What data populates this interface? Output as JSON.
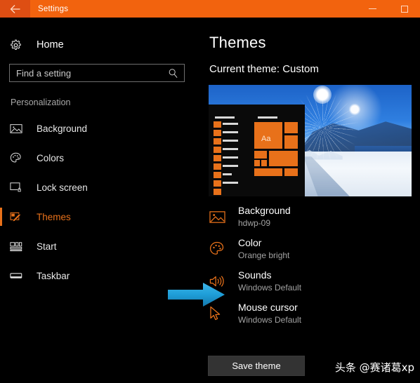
{
  "window": {
    "title": "Settings",
    "back_icon": "back-arrow-icon",
    "minimize_label": "—",
    "maximize_label": "□",
    "close_label": "✕",
    "titlebar_color": "#F2630E",
    "back_button_color": "#DE4E13"
  },
  "sidebar": {
    "home": {
      "label": "Home",
      "icon": "gear-icon"
    },
    "search": {
      "placeholder": "Find a setting",
      "value": "",
      "icon": "search-icon"
    },
    "section_title": "Personalization",
    "accent_color": "#E8711A",
    "items": [
      {
        "label": "Background",
        "icon": "picture-icon",
        "active": false
      },
      {
        "label": "Colors",
        "icon": "palette-icon",
        "active": false
      },
      {
        "label": "Lock screen",
        "icon": "lock-screen-icon",
        "active": false
      },
      {
        "label": "Themes",
        "icon": "themes-brush-icon",
        "active": true
      },
      {
        "label": "Start",
        "icon": "start-tiles-icon",
        "active": false
      },
      {
        "label": "Taskbar",
        "icon": "taskbar-icon",
        "active": false
      }
    ]
  },
  "main": {
    "page_title": "Themes",
    "current_theme": "Current theme: Custom",
    "preview": {
      "name": "theme-preview",
      "tile_letter": "Aa",
      "accent_color": "#E8711A"
    },
    "options": [
      {
        "title": "Background",
        "value": "hdwp-09",
        "icon": "picture-icon"
      },
      {
        "title": "Color",
        "value": "Orange bright",
        "icon": "palette-icon"
      },
      {
        "title": "Sounds",
        "value": "Windows Default",
        "icon": "speaker-icon"
      },
      {
        "title": "Mouse cursor",
        "value": "Windows Default",
        "icon": "cursor-icon"
      }
    ],
    "save_button": "Save theme"
  },
  "annotation": {
    "arrow_color": "#1C9AD6",
    "points_to": "Sounds"
  },
  "watermark": "头条 @赛诸葛xp"
}
